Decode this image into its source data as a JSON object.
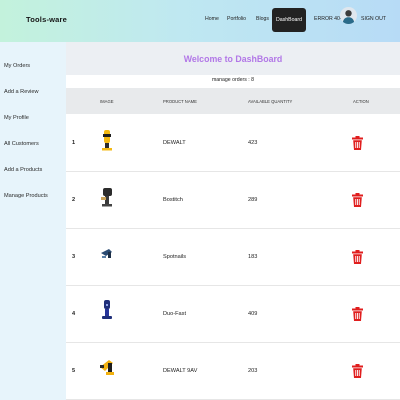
{
  "navbar": {
    "brand": "Tools-ware",
    "links": [
      "Home",
      "Portfolio",
      "Blogs",
      "DashBoard"
    ],
    "user_name": "ERROR 404",
    "signout_label": "SIGN OUT"
  },
  "sidebar": {
    "items": [
      "My Orders",
      "Add a Review",
      "My Profile",
      "All Customers",
      "Add a Products",
      "Manage Products"
    ]
  },
  "main": {
    "welcome": "Welcome to DashBoard",
    "orders_count": "manage orders : 8"
  },
  "table": {
    "headers": [
      "IMAGE",
      "PRODUCT NAME",
      "AVAILABLE QUANTITY",
      "ACTION"
    ],
    "rows": [
      {
        "num": "1",
        "product": "DEWALT",
        "quantity": "423",
        "image": "yellow-tool-image"
      },
      {
        "num": "2",
        "product": "Bostitch",
        "quantity": "289",
        "image": "dark-tool-image"
      },
      {
        "num": "3",
        "product": "Spotnails",
        "quantity": "183",
        "image": "blue-tool-image"
      },
      {
        "num": "4",
        "product": "Duo-Fast",
        "quantity": "409",
        "image": "navy-tool-image"
      },
      {
        "num": "5",
        "product": "DEWALT 9AV",
        "quantity": "203",
        "image": "yellow-drill-image"
      }
    ]
  },
  "colors": {
    "welcome_text": "#b277e7",
    "trash": "#e01e1e",
    "dashboard_bg": "#222222"
  },
  "icons": {
    "action": "trash-icon"
  }
}
